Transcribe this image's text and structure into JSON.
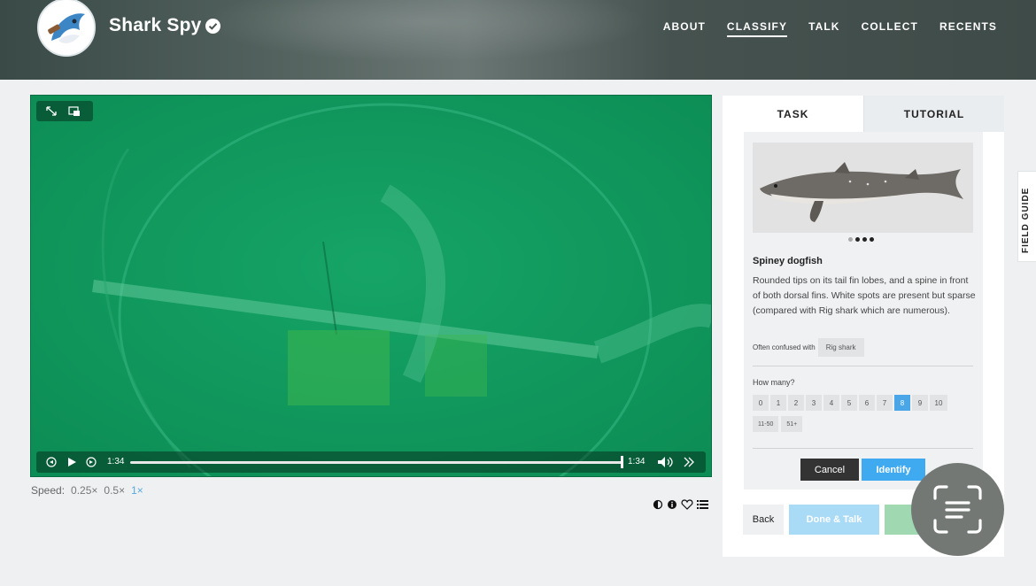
{
  "header": {
    "project_name": "Shark Spy",
    "nav": [
      {
        "label": "ABOUT",
        "active": false
      },
      {
        "label": "CLASSIFY",
        "active": true
      },
      {
        "label": "TALK",
        "active": false
      },
      {
        "label": "COLLECT",
        "active": false
      },
      {
        "label": "RECENTS",
        "active": false
      }
    ]
  },
  "video": {
    "current_time": "1:34",
    "duration": "1:34",
    "progress": 1.0
  },
  "speed": {
    "label": "Speed:",
    "options": [
      "0.25×",
      "0.5×",
      "1×"
    ],
    "selected": "1×"
  },
  "tabs": {
    "task": "TASK",
    "tutorial": "TUTORIAL"
  },
  "species": {
    "name": "Spiney dogfish",
    "description": "Rounded tips on its tail fin lobes, and a spine in front of both dorsal fins. White spots are present but sparse (compared with Rig shark which are numerous).",
    "confused_label": "Often confused with",
    "confused_with": "Rig shark",
    "image_count": 4,
    "image_index": 0
  },
  "count": {
    "question": "How many?",
    "options": [
      "0",
      "1",
      "2",
      "3",
      "4",
      "5",
      "6",
      "7",
      "8",
      "9",
      "10"
    ],
    "extra_options": [
      "11-50",
      "51+"
    ],
    "selected": "8"
  },
  "actions": {
    "cancel": "Cancel",
    "identify": "Identify",
    "back": "Back",
    "done_talk": "Done & Talk"
  },
  "field_guide": "FIELD GUIDE",
  "colors": {
    "accent": "#40aaf0",
    "video_bg": "#0f9a5e",
    "done": "#9fd8b1"
  }
}
